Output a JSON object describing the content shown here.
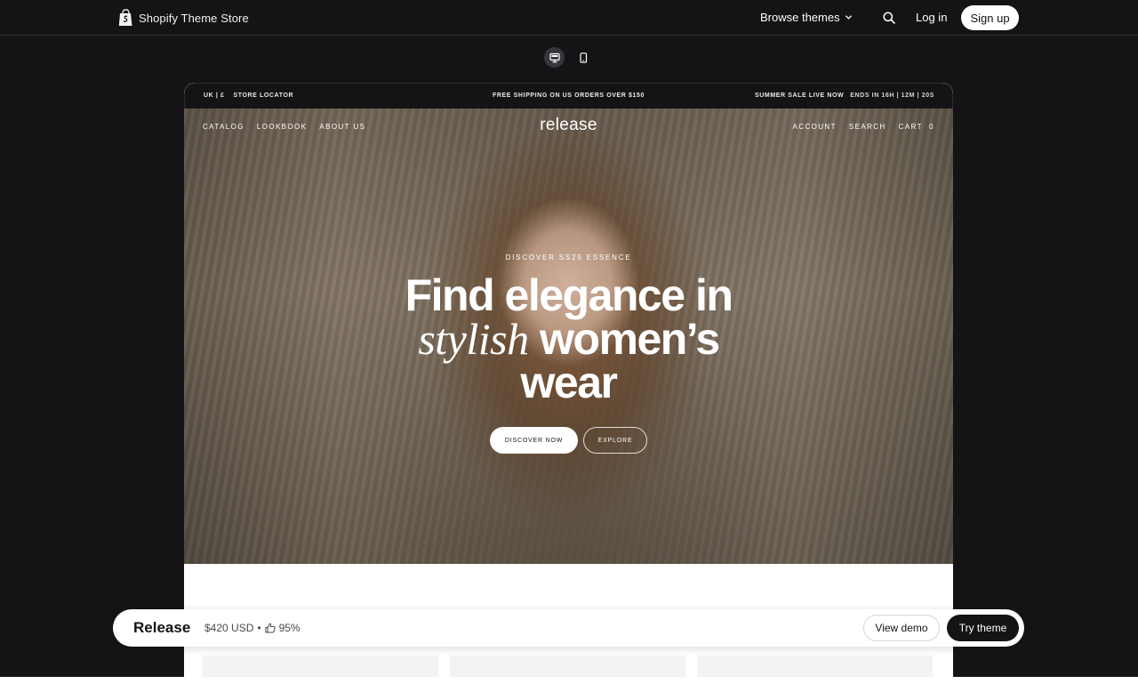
{
  "topnav": {
    "logo_text": "Shopify Theme Store",
    "browse_label": "Browse themes",
    "login_label": "Log in",
    "signup_label": "Sign up"
  },
  "device_toggle": {
    "options": [
      "desktop-icon",
      "mobile-icon"
    ],
    "selected": "desktop-icon"
  },
  "preview": {
    "announcement": {
      "locale": "UK | £",
      "store_locator": "STORE LOCATOR",
      "shipping": "FREE SHIPPING ON US ORDERS OVER $150",
      "sale": "SUMMER SALE LIVE NOW",
      "countdown": "ENDS IN 16H | 12M | 20S"
    },
    "nav_left": [
      "CATALOG",
      "LOOKBOOK",
      "ABOUT US"
    ],
    "brand": "release",
    "nav_right": [
      "ACCOUNT",
      "SEARCH",
      "CART"
    ],
    "cart_count": "0",
    "hero": {
      "eyebrow": "DISCOVER SS25 ESSENCE",
      "headline_line1": "Find elegance in",
      "headline_italic": "stylish",
      "headline_line2_rest": "women’s",
      "headline_line3": "wear",
      "cta_primary": "DISCOVER NOW",
      "cta_secondary": "EXPLORE"
    }
  },
  "bottom_bar": {
    "theme_name": "Release",
    "price": "$420 USD",
    "separator": "•",
    "rating": "95%",
    "view_demo_label": "View demo",
    "try_theme_label": "Try theme"
  },
  "colors": {
    "dark_bg": "#141315",
    "white": "#ffffff"
  }
}
